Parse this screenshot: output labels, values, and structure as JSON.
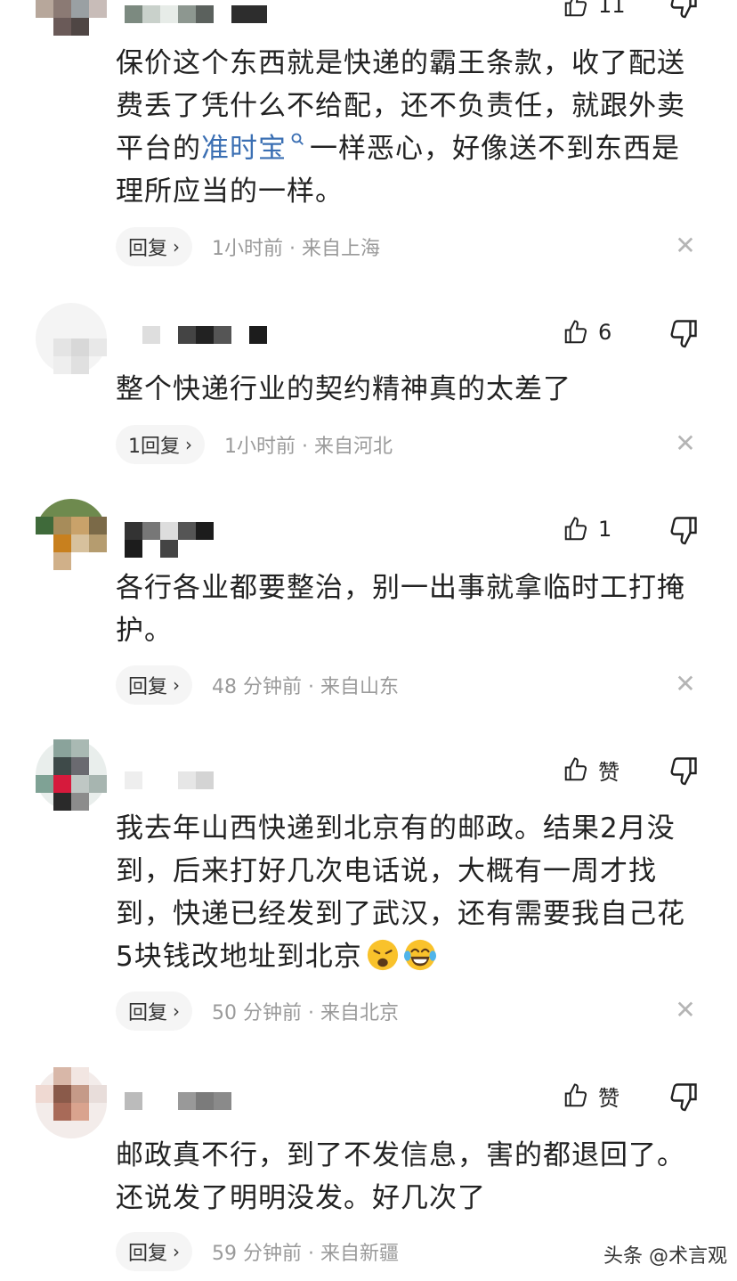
{
  "comments": [
    {
      "likes": "11",
      "text_parts": [
        "保价这个东西就是快递的霸王条款，收了配送费丢了凭什么不给配，还不负责任，就跟外卖平台的",
        "准时宝",
        "一样恶心，好像送不到东西是理所应当的一样。"
      ],
      "reply_label": "回复",
      "meta": "1小时前 · 来自上海"
    },
    {
      "likes": "6",
      "text": "整个快递行业的契约精神真的太差了",
      "reply_label": "1回复",
      "meta": "1小时前 · 来自河北"
    },
    {
      "likes": "1",
      "text": "各行各业都要整治，别一出事就拿临时工打掩护。",
      "reply_label": "回复",
      "meta": "48 分钟前 · 来自山东"
    },
    {
      "likes": "赞",
      "text": "我去年山西快递到北京有的邮政。结果2月没到，后来打好几次电话说，大概有一周才找到，快递已经发到了武汉，还有需要我自己花5块钱改地址到北京",
      "reply_label": "回复",
      "meta": "50 分钟前 · 来自北京"
    },
    {
      "likes": "赞",
      "text": "邮政真不行，到了不发信息，害的都退回了。还说发了明明没发。好几次了",
      "reply_label": "回复",
      "meta": "59 分钟前 · 来自新疆"
    }
  ],
  "watermark": "头条 @术言观",
  "icons": {
    "like": "thumbs-up-icon",
    "dislike": "thumbs-down-icon",
    "close": "close-icon",
    "chevron": "chevron-right-icon",
    "search": "search-icon",
    "emoji1": "tired-face-emoji",
    "emoji2": "laughing-tears-emoji"
  },
  "colors": {
    "link": "#3b6fb3",
    "meta": "#9a9a9a",
    "reply_bg": "#f5f5f5"
  }
}
